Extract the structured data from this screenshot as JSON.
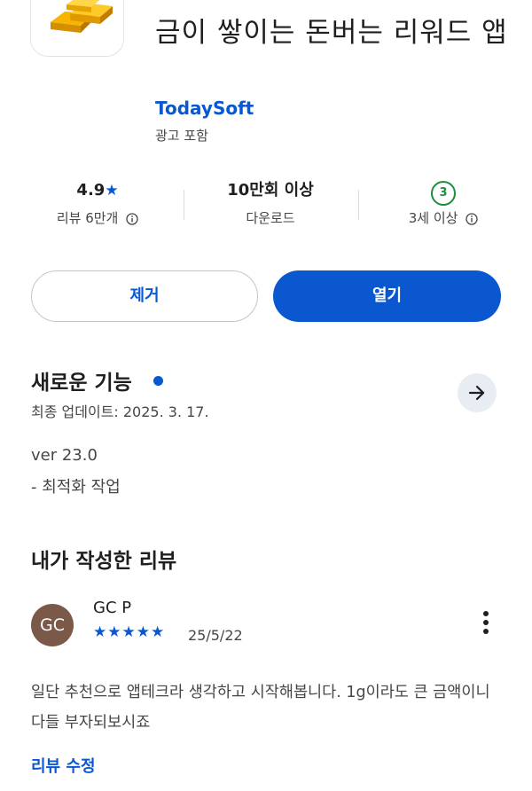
{
  "app": {
    "title": "금이 쌓이는 돈버는 리워드 앱",
    "developer": "TodaySoft",
    "ads_label": "광고 포함",
    "icon": "gold-bars-icon"
  },
  "stats": {
    "rating_value": "4.9",
    "rating_star": "★",
    "reviews_label": "리뷰 6만개",
    "downloads_value": "10만회 이상",
    "downloads_label": "다운로드",
    "age_badge": "3",
    "age_label": "3세 이상"
  },
  "buttons": {
    "remove": "제거",
    "open": "열기"
  },
  "whats_new": {
    "title": "새로운 기능",
    "updated": "최종 업데이트: 2025. 3. 17.",
    "version": "ver 23.0",
    "notes": "- 최적화 작업"
  },
  "my_review": {
    "heading": "내가 작성한 리뷰",
    "avatar_initials": "GC",
    "author": "GC P",
    "stars": "★★★★★",
    "rating": 5,
    "date": "25/5/22",
    "text": "일단 추천으로 앱테크라 생각하고 시작해봅니다. 1g이라도 큰 금액이니 다들 부자되보시죠",
    "edit_label": "리뷰 수정"
  },
  "colors": {
    "accent": "#0b57d0",
    "age_green": "#1e8e3e",
    "avatar_bg": "#7a5948"
  }
}
